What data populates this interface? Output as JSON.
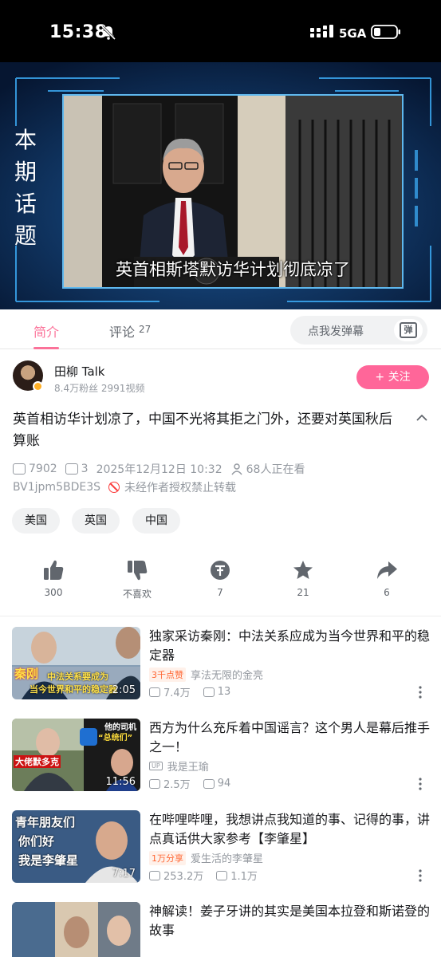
{
  "status_bar": {
    "time": "15:38",
    "network": "5GA"
  },
  "video": {
    "topic_text": [
      "本",
      "期",
      "话",
      "题"
    ],
    "subtitle": "英首相斯塔默访华计划彻底凉了"
  },
  "tabs": {
    "intro": "简介",
    "comments": "评论",
    "comments_count": "27",
    "danmaku_placeholder": "点我发弹幕",
    "danmaku_icon": "弹"
  },
  "uploader": {
    "name": "田柳 Talk",
    "stats": "8.4万粉丝  2991视频",
    "follow_label": "+ 关注"
  },
  "video_info": {
    "title": "英首相访华计划凉了，中国不光将其拒之门外，还要对英国秋后算账",
    "views": "7902",
    "danmaku": "3",
    "date": "2025年12月12日 10:32",
    "watching": "68人正在看",
    "bvid": "BV1jpm5BDE3S",
    "notice": "未经作者授权禁止转载"
  },
  "tags": [
    "美国",
    "英国",
    "中国"
  ],
  "actions": [
    {
      "icon": "thumbs-up-icon",
      "label": "300"
    },
    {
      "icon": "thumbs-down-icon",
      "label": "不喜欢"
    },
    {
      "icon": "coin-icon",
      "label": "7"
    },
    {
      "icon": "star-icon",
      "label": "21"
    },
    {
      "icon": "share-icon",
      "label": "6"
    }
  ],
  "recommendations": [
    {
      "title": "独家采访秦刚：中法关系应成为当今世界和平的稳定器",
      "badge": "3千点赞",
      "author": "享法无限的金亮",
      "views": "7.4万",
      "danmaku": "13",
      "duration": "2:05",
      "thumb_text": [
        "秦刚",
        "中法关系要成为",
        "当今世界和平的稳定器"
      ]
    },
    {
      "title": "西方为什么充斥着中国谣言？这个男人是幕后推手之一！",
      "badge": "",
      "author": "我是王瑜",
      "views": "2.5万",
      "danmaku": "94",
      "duration": "11:56",
      "thumb_text": [
        "大佬默多克",
        "他的司机",
        "“总统们”"
      ]
    },
    {
      "title": "在哔哩哔哩，我想讲点我知道的事、记得的事，讲点真话供大家参考【李肇星】",
      "badge": "1万分享",
      "author": "爱生活的李肇星",
      "views": "253.2万",
      "danmaku": "1.1万",
      "duration": "7:17",
      "thumb_text": [
        "青年朋友们",
        "你们好",
        "我是李肇星"
      ]
    },
    {
      "title": "神解读！姜子牙讲的其实是美国本拉登和斯诺登的故事",
      "badge": "",
      "author": "",
      "views": "",
      "danmaku": "",
      "duration": "",
      "thumb_text": []
    }
  ],
  "colors": {
    "brand_pink": "#fb7299",
    "follow_pink": "#ff6699",
    "gray_text": "#9499a0"
  }
}
